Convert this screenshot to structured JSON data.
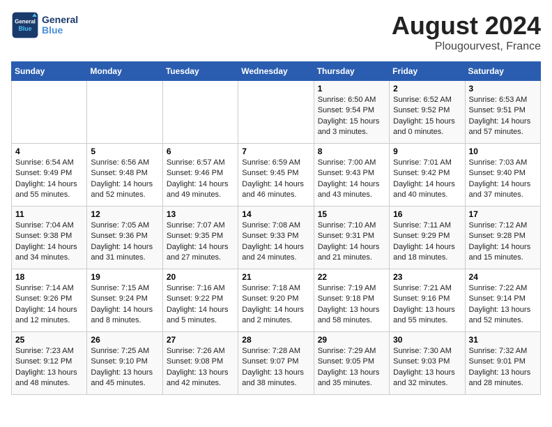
{
  "header": {
    "logo_text_general": "General",
    "logo_text_blue": "Blue",
    "title": "August 2024",
    "subtitle": "Plougourvest, France"
  },
  "calendar": {
    "days_of_week": [
      "Sunday",
      "Monday",
      "Tuesday",
      "Wednesday",
      "Thursday",
      "Friday",
      "Saturday"
    ],
    "weeks": [
      [
        {
          "day": "",
          "info": ""
        },
        {
          "day": "",
          "info": ""
        },
        {
          "day": "",
          "info": ""
        },
        {
          "day": "",
          "info": ""
        },
        {
          "day": "1",
          "info": "Sunrise: 6:50 AM\nSunset: 9:54 PM\nDaylight: 15 hours\nand 3 minutes."
        },
        {
          "day": "2",
          "info": "Sunrise: 6:52 AM\nSunset: 9:52 PM\nDaylight: 15 hours\nand 0 minutes."
        },
        {
          "day": "3",
          "info": "Sunrise: 6:53 AM\nSunset: 9:51 PM\nDaylight: 14 hours\nand 57 minutes."
        }
      ],
      [
        {
          "day": "4",
          "info": "Sunrise: 6:54 AM\nSunset: 9:49 PM\nDaylight: 14 hours\nand 55 minutes."
        },
        {
          "day": "5",
          "info": "Sunrise: 6:56 AM\nSunset: 9:48 PM\nDaylight: 14 hours\nand 52 minutes."
        },
        {
          "day": "6",
          "info": "Sunrise: 6:57 AM\nSunset: 9:46 PM\nDaylight: 14 hours\nand 49 minutes."
        },
        {
          "day": "7",
          "info": "Sunrise: 6:59 AM\nSunset: 9:45 PM\nDaylight: 14 hours\nand 46 minutes."
        },
        {
          "day": "8",
          "info": "Sunrise: 7:00 AM\nSunset: 9:43 PM\nDaylight: 14 hours\nand 43 minutes."
        },
        {
          "day": "9",
          "info": "Sunrise: 7:01 AM\nSunset: 9:42 PM\nDaylight: 14 hours\nand 40 minutes."
        },
        {
          "day": "10",
          "info": "Sunrise: 7:03 AM\nSunset: 9:40 PM\nDaylight: 14 hours\nand 37 minutes."
        }
      ],
      [
        {
          "day": "11",
          "info": "Sunrise: 7:04 AM\nSunset: 9:38 PM\nDaylight: 14 hours\nand 34 minutes."
        },
        {
          "day": "12",
          "info": "Sunrise: 7:05 AM\nSunset: 9:36 PM\nDaylight: 14 hours\nand 31 minutes."
        },
        {
          "day": "13",
          "info": "Sunrise: 7:07 AM\nSunset: 9:35 PM\nDaylight: 14 hours\nand 27 minutes."
        },
        {
          "day": "14",
          "info": "Sunrise: 7:08 AM\nSunset: 9:33 PM\nDaylight: 14 hours\nand 24 minutes."
        },
        {
          "day": "15",
          "info": "Sunrise: 7:10 AM\nSunset: 9:31 PM\nDaylight: 14 hours\nand 21 minutes."
        },
        {
          "day": "16",
          "info": "Sunrise: 7:11 AM\nSunset: 9:29 PM\nDaylight: 14 hours\nand 18 minutes."
        },
        {
          "day": "17",
          "info": "Sunrise: 7:12 AM\nSunset: 9:28 PM\nDaylight: 14 hours\nand 15 minutes."
        }
      ],
      [
        {
          "day": "18",
          "info": "Sunrise: 7:14 AM\nSunset: 9:26 PM\nDaylight: 14 hours\nand 12 minutes."
        },
        {
          "day": "19",
          "info": "Sunrise: 7:15 AM\nSunset: 9:24 PM\nDaylight: 14 hours\nand 8 minutes."
        },
        {
          "day": "20",
          "info": "Sunrise: 7:16 AM\nSunset: 9:22 PM\nDaylight: 14 hours\nand 5 minutes."
        },
        {
          "day": "21",
          "info": "Sunrise: 7:18 AM\nSunset: 9:20 PM\nDaylight: 14 hours\nand 2 minutes."
        },
        {
          "day": "22",
          "info": "Sunrise: 7:19 AM\nSunset: 9:18 PM\nDaylight: 13 hours\nand 58 minutes."
        },
        {
          "day": "23",
          "info": "Sunrise: 7:21 AM\nSunset: 9:16 PM\nDaylight: 13 hours\nand 55 minutes."
        },
        {
          "day": "24",
          "info": "Sunrise: 7:22 AM\nSunset: 9:14 PM\nDaylight: 13 hours\nand 52 minutes."
        }
      ],
      [
        {
          "day": "25",
          "info": "Sunrise: 7:23 AM\nSunset: 9:12 PM\nDaylight: 13 hours\nand 48 minutes."
        },
        {
          "day": "26",
          "info": "Sunrise: 7:25 AM\nSunset: 9:10 PM\nDaylight: 13 hours\nand 45 minutes."
        },
        {
          "day": "27",
          "info": "Sunrise: 7:26 AM\nSunset: 9:08 PM\nDaylight: 13 hours\nand 42 minutes."
        },
        {
          "day": "28",
          "info": "Sunrise: 7:28 AM\nSunset: 9:07 PM\nDaylight: 13 hours\nand 38 minutes."
        },
        {
          "day": "29",
          "info": "Sunrise: 7:29 AM\nSunset: 9:05 PM\nDaylight: 13 hours\nand 35 minutes."
        },
        {
          "day": "30",
          "info": "Sunrise: 7:30 AM\nSunset: 9:03 PM\nDaylight: 13 hours\nand 32 minutes."
        },
        {
          "day": "31",
          "info": "Sunrise: 7:32 AM\nSunset: 9:01 PM\nDaylight: 13 hours\nand 28 minutes."
        }
      ]
    ]
  }
}
